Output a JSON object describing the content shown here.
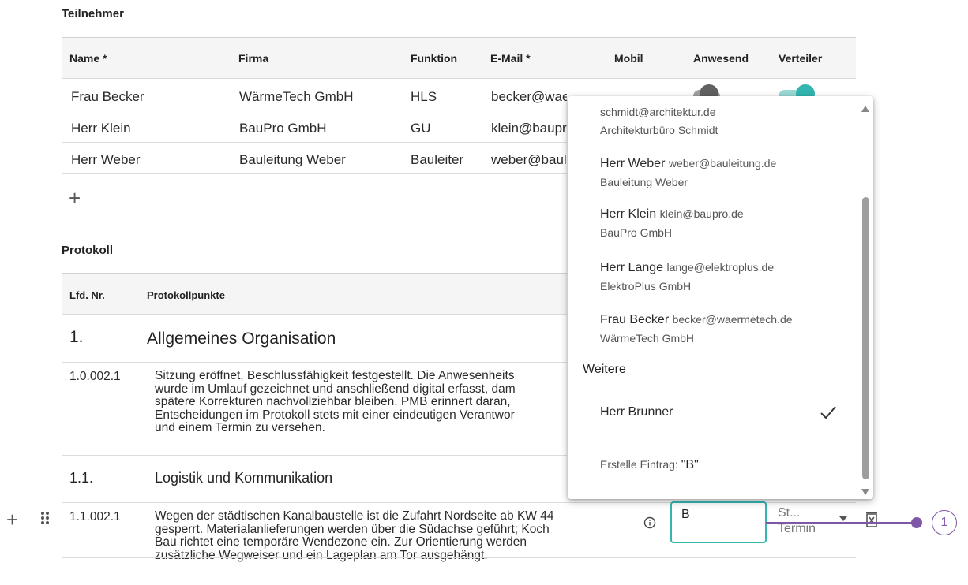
{
  "participants": {
    "section_title": "Teilnehmer",
    "columns": [
      "Name *",
      "Firma",
      "Funktion",
      "E-Mail *",
      "Mobil",
      "Anwesend",
      "Verteiler"
    ],
    "rows": [
      {
        "name": "Frau Becker",
        "firma": "WärmeTech GmbH",
        "funktion": "HLS",
        "email": "becker@waermete..de Schmidt"
      },
      {
        "name": "Herr Klein",
        "firma": "BauPro GmbH",
        "funktion": "GU",
        "email": "klein@baupr"
      },
      {
        "name": "Herr Weber",
        "firma": "Bauleitung Weber",
        "funktion": "Bauleiter",
        "email": "weber@baul"
      }
    ],
    "add_label": "+"
  },
  "protocol": {
    "section_title": "Protokoll",
    "columns": [
      "Lfd. Nr.",
      "Protokollpunkte"
    ],
    "groups": [
      {
        "nr": "1.",
        "title": "Allgemeines Organisation"
      },
      {
        "nr": "1.1.",
        "title": "Logistik und Kommunikation"
      }
    ],
    "items": [
      {
        "nr": "1.0.002.1",
        "lines": [
          "Sitzung eröffnet, Beschlussfähigkeit festgestellt. Die Anwesenheits",
          "wurde im Umlauf gezeichnet und anschließend digital erfasst, dam",
          "spätere Korrekturen nachvollziehbar bleiben. PMB erinnert daran,",
          "Entscheidungen im Protokoll stets mit einer eindeutigen Verantwor",
          "und einem Termin zu versehen."
        ]
      },
      {
        "nr": "1.1.002.1",
        "lines": [
          "Wegen der städtischen Kanalbaustelle ist die Zufahrt Nordseite ab KW 44",
          "gesperrt. Materialanlieferungen werden über die Südachse geführt; Koch",
          "Bau richtet eine temporäre Wendezone ein. Zur Orientierung werden",
          "zusätzliche Wegweiser und ein Lageplan am Tor ausgehängt."
        ]
      }
    ],
    "responsible_input_value": "B",
    "status_line1": "St...",
    "status_line2": "Termin",
    "annotation_marker": "1"
  },
  "dropdown": {
    "options": [
      {
        "name": "",
        "mail": "schmidt@architektur.de",
        "sub": "Architekturbüro Schmidt"
      },
      {
        "name": "Herr Weber",
        "mail": "weber@bauleitung.de",
        "sub": "Bauleitung Weber"
      },
      {
        "name": "Herr Klein",
        "mail": "klein@baupro.de",
        "sub": "BauPro GmbH"
      },
      {
        "name": "Herr Lange",
        "mail": "lange@elektroplus.de",
        "sub": "ElektroPlus GmbH"
      },
      {
        "name": "Frau Becker",
        "mail": "becker@waermetech.de",
        "sub": "WärmeTech GmbH"
      }
    ],
    "group_label": "Weitere",
    "extra_option": "Herr Brunner",
    "create_prefix": "Erstelle Eintrag: ",
    "create_value": "\"B\""
  },
  "colors": {
    "accent": "#33b5b0",
    "toggle_off": "#616161",
    "annotation": "#7e57a6"
  },
  "icons": [
    "add-icon",
    "drag-handle-icon",
    "info-icon",
    "dropdown-arrow-icon",
    "delete-icon",
    "check-icon"
  ]
}
